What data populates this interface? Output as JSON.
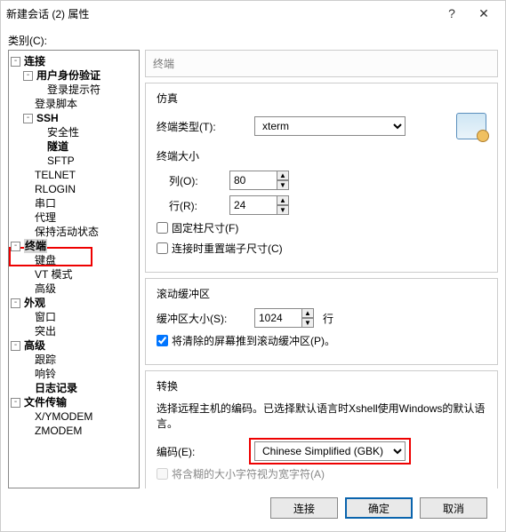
{
  "window": {
    "title": "新建会话 (2) 属性"
  },
  "category_label": "类别(C):",
  "tree": {
    "root": "连接",
    "auth": "用户身份验证",
    "loginprompt": "登录提示符",
    "loginscript": "登录脚本",
    "ssh": "SSH",
    "security": "安全性",
    "tunnel": "隧道",
    "sftp": "SFTP",
    "telnet": "TELNET",
    "rlogin": "RLOGIN",
    "serial": "串口",
    "proxy": "代理",
    "keepalive": "保持活动状态",
    "terminal": "终端",
    "keyboard": "键盘",
    "vtmode": "VT 模式",
    "advanced_t": "高级",
    "appearance": "外观",
    "window": "窗口",
    "highlight": "突出",
    "advanced": "高级",
    "trace": "跟踪",
    "bell": "响铃",
    "logging": "日志记录",
    "filetransfer": "文件传输",
    "xymodem": "X/YMODEM",
    "zmodem": "ZMODEM"
  },
  "path": "终端",
  "emulation": {
    "title": "仿真",
    "term_type_label": "终端类型(T):",
    "term_type_value": "xterm"
  },
  "size": {
    "title": "终端大小",
    "cols_label": "列(O):",
    "cols_value": "80",
    "rows_label": "行(R):",
    "rows_value": "24",
    "fixed_cols_label": "固定柱尺寸(F)",
    "reset_on_connect_label": "连接时重置端子尺寸(C)"
  },
  "scroll": {
    "title": "滚动缓冲区",
    "size_label": "缓冲区大小(S):",
    "size_value": "1024",
    "unit": "行",
    "push_label": "将清除的屏幕推到滚动缓冲区(P)。"
  },
  "convert": {
    "title": "转换",
    "hint": "选择远程主机的编码。已选择默认语言时Xshell使用Windows的默认语言。",
    "encoding_label": "编码(E):",
    "encoding_value": "Chinese Simplified (GBK)",
    "widechar_label": "将含糊的大小字符视为宽字符(A)"
  },
  "buttons": {
    "connect": "连接",
    "ok": "确定",
    "cancel": "取消"
  }
}
